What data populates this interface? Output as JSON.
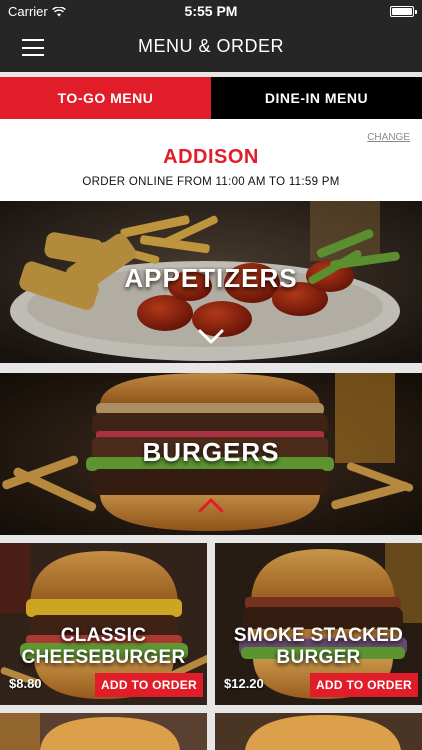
{
  "status_bar": {
    "carrier": "Carrier",
    "time": "5:55 PM"
  },
  "nav": {
    "title": "MENU & ORDER"
  },
  "tabs": [
    {
      "label": "TO-GO MENU",
      "active": true
    },
    {
      "label": "DINE-IN MENU",
      "active": false
    }
  ],
  "location": {
    "change_label": "CHANGE",
    "name": "ADDISON",
    "hours": "ORDER ONLINE FROM 11:00 AM TO 11:59 PM"
  },
  "categories": [
    {
      "title": "APPETIZERS",
      "expanded": false
    },
    {
      "title": "BURGERS",
      "expanded": true
    }
  ],
  "products": [
    {
      "title_line1": "CLASSIC",
      "title_line2": "CHEESEBURGER",
      "price": "$8.80",
      "button": "ADD TO ORDER"
    },
    {
      "title_line1": "SMOKE STACKED",
      "title_line2": "BURGER",
      "price": "$12.20",
      "button": "ADD TO ORDER"
    }
  ],
  "colors": {
    "accent": "#e11d2a",
    "nav_bg": "#262626",
    "tab_inactive": "#000000"
  }
}
